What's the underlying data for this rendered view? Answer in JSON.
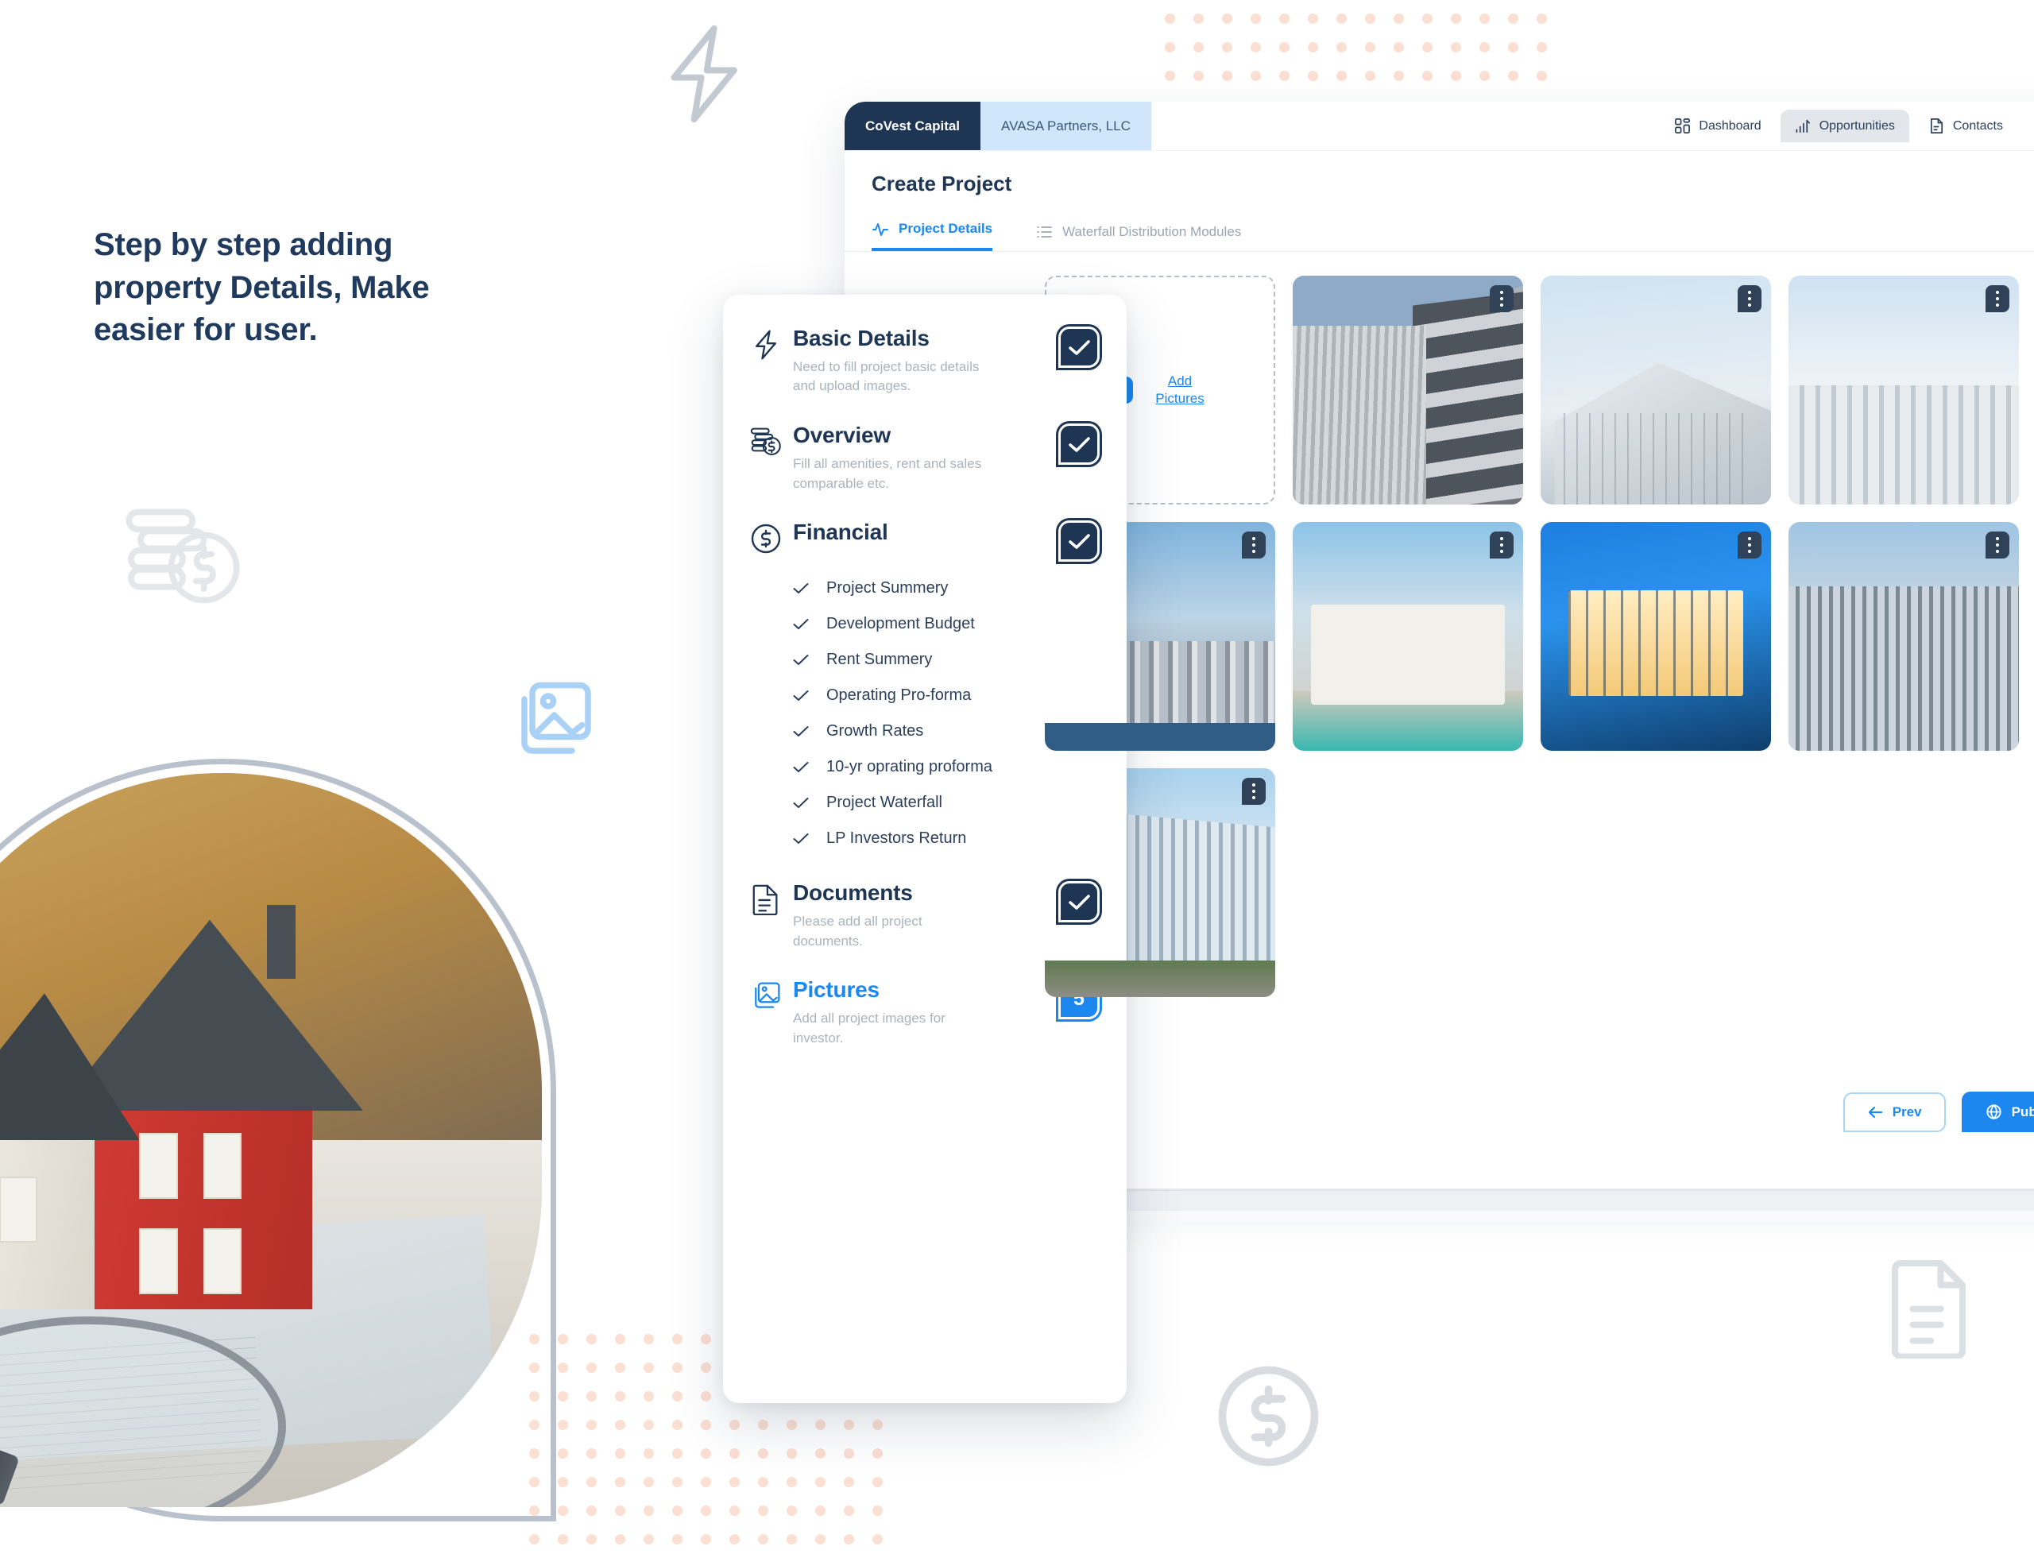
{
  "promo": {
    "headline": "Step by step adding property Details, Make easier for user.",
    "decor": {
      "bolt": "lightning-bolt-icon",
      "coins": "coins-money-icon",
      "gallery": "image-gallery-icon",
      "dollar": "dollar-circle-icon",
      "document": "document-icon"
    }
  },
  "app": {
    "org_tab": "CoVest Capital",
    "org_tab_alt": "AVASA Partners, LLC",
    "nav": [
      {
        "label": "Dashboard",
        "icon": "dashboard-icon",
        "active": false
      },
      {
        "label": "Opportunities",
        "icon": "bar-chart-icon",
        "active": true
      },
      {
        "label": "Contacts",
        "icon": "contacts-document-icon",
        "active": false
      }
    ],
    "avatar": "user-avatar",
    "page_title": "Create Project",
    "tabs": [
      {
        "label": "Project Details",
        "icon": "activity-pulse-icon",
        "active": true
      },
      {
        "label": "Waterfall Distribution Modules",
        "icon": "list-icon",
        "active": false
      }
    ],
    "dropzone": {
      "plus": "plus-icon",
      "label": "Add Pictures"
    },
    "pictures": [
      {
        "name": "modern-apartment-facade",
        "menu": "kebab-menu-icon"
      },
      {
        "name": "glass-atrium-building",
        "menu": "kebab-menu-icon"
      },
      {
        "name": "white-office-building",
        "menu": "kebab-menu-icon"
      },
      {
        "name": "city-skyline-waterfront",
        "menu": "kebab-menu-icon"
      },
      {
        "name": "modern-villa-pool",
        "menu": "kebab-menu-icon"
      },
      {
        "name": "illuminated-glass-house",
        "menu": "kebab-menu-icon"
      },
      {
        "name": "high-rise-towers",
        "menu": "kebab-menu-icon"
      },
      {
        "name": "glass-office-street-view",
        "menu": "kebab-menu-icon"
      }
    ],
    "footer": {
      "prev_label": "Prev",
      "prev_icon": "arrow-left-icon",
      "publish_label": "Publish",
      "publish_icon": "globe-icon"
    }
  },
  "steps": [
    {
      "id": "basic-details",
      "title": "Basic Details",
      "desc": "Need to fill project basic details and upload images.",
      "icon": "lightning-bolt-icon",
      "badge": "check",
      "active": false
    },
    {
      "id": "overview",
      "title": "Overview",
      "desc": "Fill all amenities, rent and sales comparable etc.",
      "icon": "coins-money-icon",
      "badge": "check",
      "active": false
    },
    {
      "id": "financial",
      "title": "Financial",
      "desc": "",
      "icon": "dollar-circle-icon",
      "badge": "check",
      "active": false,
      "sub_items": [
        "Project Summery",
        "Development Budget",
        "Rent Summery",
        "Operating Pro-forma",
        "Growth Rates",
        "10-yr oprating proforma",
        "Project Waterfall",
        "LP Investors Return"
      ]
    },
    {
      "id": "documents",
      "title": "Documents",
      "desc": "Please add all project documents.",
      "icon": "document-icon",
      "badge": "check",
      "active": false
    },
    {
      "id": "pictures",
      "title": "Pictures",
      "desc": "Add all project images for investor.",
      "icon": "image-gallery-icon",
      "badge": "5",
      "active": true
    }
  ],
  "colors": {
    "navy": "#1e3553",
    "blue": "#1b87ef",
    "muted": "#aab2bb",
    "dot_peach": "#fbdfd3",
    "decor_grey": "#dfe3e8"
  }
}
